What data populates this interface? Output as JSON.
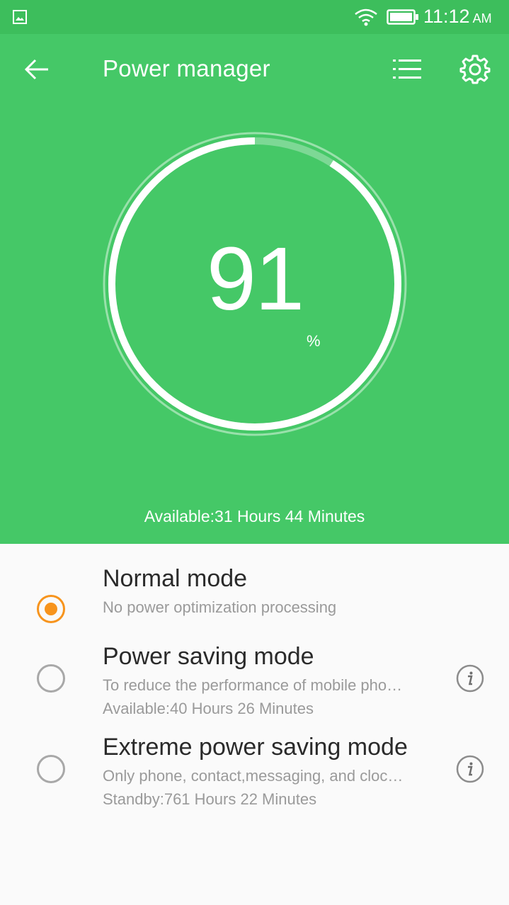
{
  "status_bar": {
    "time": "11:12",
    "ampm": "AM",
    "icons": [
      "gallery-icon",
      "wifi-icon",
      "battery-icon"
    ]
  },
  "header": {
    "title": "Power manager",
    "icons": [
      "back-arrow-icon",
      "list-icon",
      "gear-icon"
    ]
  },
  "battery": {
    "level": 91,
    "level_text": "91",
    "unit": "%",
    "available": "Available:31 Hours 44 Minutes"
  },
  "modes": [
    {
      "title": "Normal mode",
      "desc": "No power optimization processing",
      "extra": "",
      "selected": true
    },
    {
      "title": "Power saving mode",
      "desc": "To reduce the performance of mobile pho…",
      "extra": "Available:40 Hours 26 Minutes",
      "selected": false
    },
    {
      "title": "Extreme power saving mode",
      "desc": "Only phone, contact,messaging, and cloc…",
      "extra": "Standby:761 Hours 22 Minutes",
      "selected": false
    }
  ],
  "colors": {
    "status_bar": "#3dbe5c",
    "header": "#45c867",
    "accent": "#f7941d"
  }
}
